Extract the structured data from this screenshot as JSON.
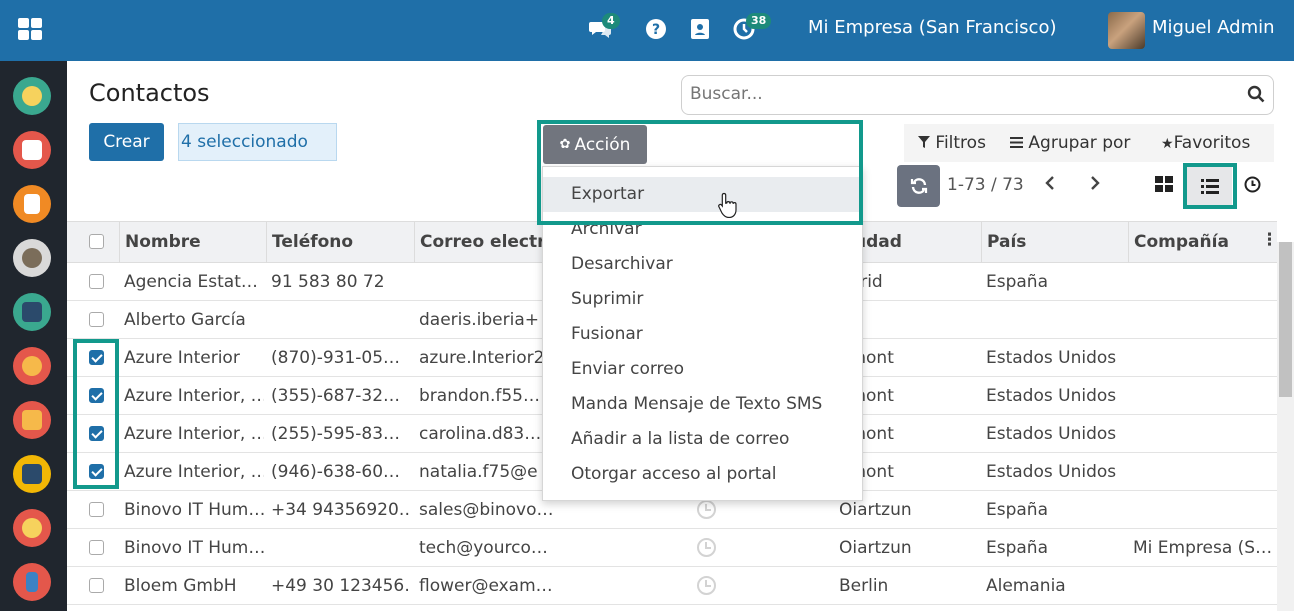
{
  "topbar": {
    "chat_badge": "4",
    "activity_badge": "38",
    "company": "Mi Empresa (San Francisco)",
    "user_name": "Miguel Admin"
  },
  "page": {
    "title": "Contactos",
    "create_label": "Crear",
    "selected_label": "4 seleccionado",
    "action_label": "Acción"
  },
  "search": {
    "placeholder": "Buscar..."
  },
  "filters": {
    "filters_label": "Filtros",
    "group_by_label": "Agrupar por",
    "favorites_label": "Favoritos"
  },
  "pager": {
    "text": "1-73 / 73"
  },
  "action_menu": {
    "items": [
      "Exportar",
      "Archivar",
      "Desarchivar",
      "Suprimir",
      "Fusionar",
      "Enviar correo",
      "Manda Mensaje de Texto SMS",
      "Añadir a la lista de correo",
      "Otorgar acceso al portal"
    ]
  },
  "table": {
    "columns": [
      "Nombre",
      "Teléfono",
      "Correo electr.",
      "Ciudad",
      "País",
      "Compañía"
    ],
    "ciudad_visible_header": "udad",
    "rows": [
      {
        "checked": false,
        "name": "Agencia Estat…",
        "phone": "91 583 80 72",
        "email": "",
        "city": "adrid",
        "country": "España",
        "company": "",
        "clock": false
      },
      {
        "checked": false,
        "name": "Alberto García",
        "phone": "",
        "email": "daeris.iberia+",
        "city": "",
        "country": "",
        "company": "",
        "clock": false
      },
      {
        "checked": true,
        "name": "Azure Interior",
        "phone": "(870)-931-05…",
        "email": "azure.Interior2",
        "city": "emont",
        "country": "Estados Unidos",
        "company": "",
        "clock": false
      },
      {
        "checked": true,
        "name": "Azure Interior, …",
        "phone": "(355)-687-32…",
        "email": "brandon.f55…",
        "city": "emont",
        "country": "Estados Unidos",
        "company": "",
        "clock": false
      },
      {
        "checked": true,
        "name": "Azure Interior, …",
        "phone": "(255)-595-83…",
        "email": "carolina.d83…",
        "city": "emont",
        "country": "Estados Unidos",
        "company": "",
        "clock": false
      },
      {
        "checked": true,
        "name": "Azure Interior, …",
        "phone": "(946)-638-60…",
        "email": "natalia.f75@e",
        "city": "emont",
        "country": "Estados Unidos",
        "company": "",
        "clock": false
      },
      {
        "checked": false,
        "name": "Binovo IT Hum…",
        "phone": "+34 94356920…",
        "email": "sales@binovo…",
        "city": "Oiartzun",
        "country": "España",
        "company": "",
        "clock": true
      },
      {
        "checked": false,
        "name": "Binovo IT Hum…",
        "phone": "",
        "email": "tech@yourco…",
        "city": "Oiartzun",
        "country": "España",
        "company": "Mi Empresa (S…",
        "clock": true
      },
      {
        "checked": false,
        "name": "Bloem GmbH",
        "phone": "+49 30 123456…",
        "email": "flower@exam…",
        "city": "Berlin",
        "country": "Alemania",
        "company": "",
        "clock": true
      }
    ]
  },
  "colors": {
    "brand": "#1f6fa8",
    "highlight": "#12998c",
    "appbar": "#20262e"
  },
  "apps": [
    {
      "icon": "discuss-app-icon",
      "color": "#3aa88f"
    },
    {
      "icon": "calendar-app-icon",
      "color": "#e4574b"
    },
    {
      "icon": "notes-app-icon",
      "color": "#f08a24"
    },
    {
      "icon": "contacts-app-icon",
      "color": "#c8c8c8"
    },
    {
      "icon": "employees-app-icon",
      "color": "#3aa88f"
    },
    {
      "icon": "crm-app-icon",
      "color": "#e4574b"
    },
    {
      "icon": "sales-app-icon",
      "color": "#e4574b"
    },
    {
      "icon": "dashboard-app-icon",
      "color": "#f2b705"
    },
    {
      "icon": "expenses-app-icon",
      "color": "#e4574b"
    },
    {
      "icon": "pos-app-icon",
      "color": "#3b82c4"
    }
  ]
}
